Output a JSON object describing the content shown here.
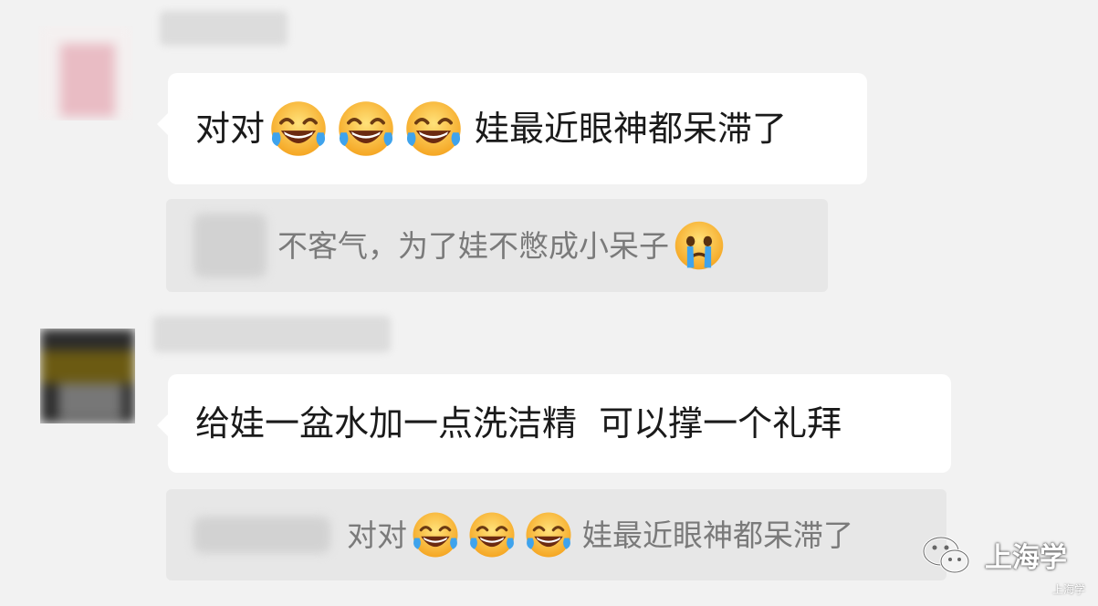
{
  "messages": [
    {
      "text_before": "对对",
      "emoji": [
        "laugh-cry-emoji",
        "laugh-cry-emoji",
        "laugh-cry-emoji"
      ],
      "text_after": "娃最近眼神都呆滞了",
      "quote": {
        "text": "不客气，为了娃不憋成小呆子",
        "emoji": "crying-emoji"
      }
    },
    {
      "text": "给娃一盆水加一点洗洁精  可以撑一个礼拜",
      "quote": {
        "text_before": "对对",
        "emoji": [
          "laugh-cry-emoji",
          "laugh-cry-emoji",
          "laugh-cry-emoji"
        ],
        "text_after": "娃最近眼神都呆滞了"
      }
    }
  ],
  "watermark": {
    "name": "上海学",
    "sub": "上海学",
    "icon": "wechat-icon"
  },
  "colors": {
    "background": "#f2f2f2",
    "bubble": "#ffffff",
    "quote_bg": "#e7e7e7",
    "quote_text": "#7a7a7a",
    "text": "#1a1a1a",
    "emoji_yellow": "#ffc83d",
    "tear_blue": "#3fa3ec"
  }
}
